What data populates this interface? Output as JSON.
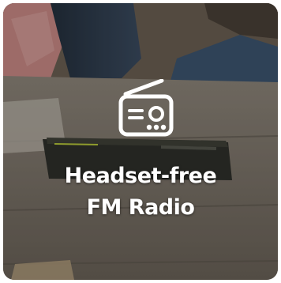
{
  "feature_card": {
    "icon": "radio-icon",
    "title_line1": "Headset-free",
    "title_line2": "FM Radio",
    "text_color": "#ffffff"
  }
}
